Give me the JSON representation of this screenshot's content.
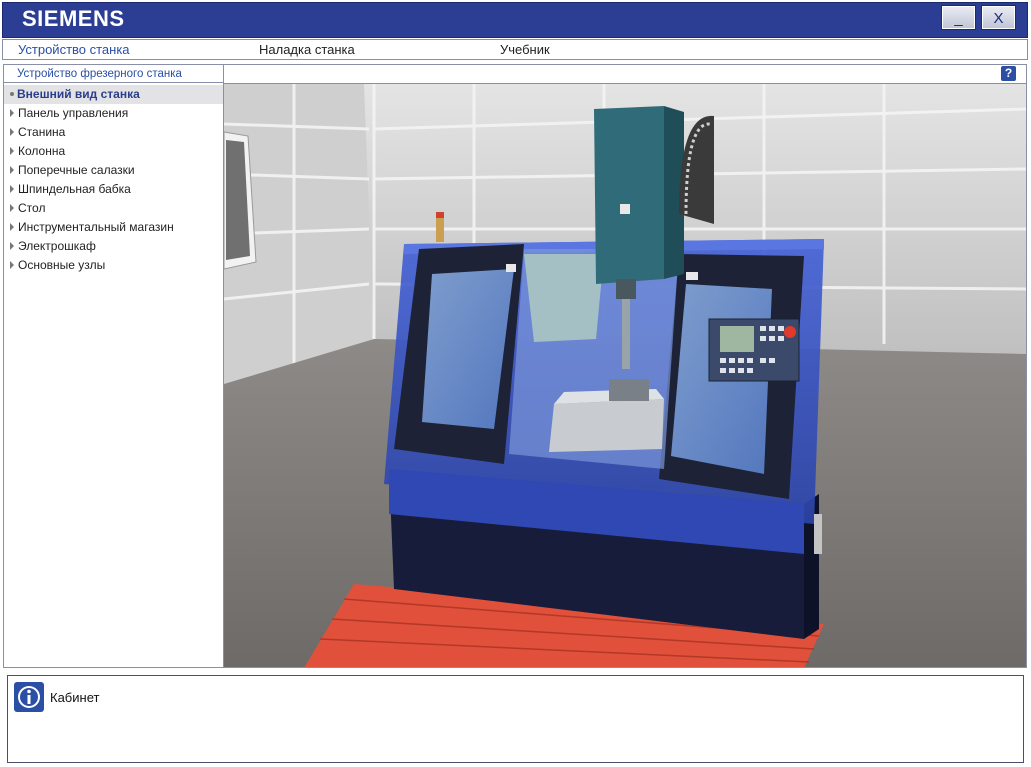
{
  "app": {
    "brand": "SIEMENS",
    "minimize_label": "_",
    "close_label": "X"
  },
  "menu": {
    "items": [
      {
        "label": "Устройство станка",
        "active": true
      },
      {
        "label": "Наладка станка",
        "active": false
      },
      {
        "label": "Учебник",
        "active": false
      }
    ]
  },
  "sidebar": {
    "header": "Устройство фрезерного станка",
    "items": [
      {
        "label": "Внешний вид станка",
        "selected": true
      },
      {
        "label": "Панель управления"
      },
      {
        "label": "Станина"
      },
      {
        "label": "Колонна"
      },
      {
        "label": "Поперечные салазки"
      },
      {
        "label": "Шпиндельная бабка"
      },
      {
        "label": "Стол"
      },
      {
        "label": "Инструментальный магазин"
      },
      {
        "label": "Электрошкаф"
      },
      {
        "label": "Основные узлы"
      }
    ]
  },
  "viewer": {
    "help_label": "?"
  },
  "info": {
    "text": "Кабинет"
  },
  "colors": {
    "titlebar": "#2c3e94",
    "accent": "#2a4fa6",
    "machine_blue": "#3a55c8",
    "floor_mat": "#e0503a"
  }
}
